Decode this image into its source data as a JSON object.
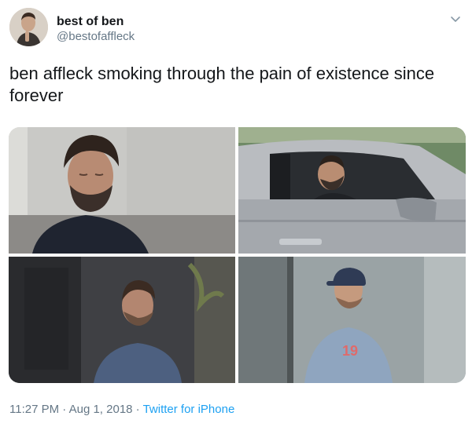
{
  "tweet": {
    "display_name": "best of ben",
    "handle": "@bestofaffleck",
    "text": "ben affleck smoking through the pain of existence since forever",
    "time": "11:27 PM",
    "separator": " · ",
    "date": "Aug 1, 2018",
    "source": "Twitter for iPhone"
  },
  "icons": {
    "menu": "chevron-down-icon"
  },
  "colors": {
    "text": "#14171a",
    "secondary": "#657786",
    "link": "#1da1f2"
  },
  "media": {
    "count": 4
  }
}
